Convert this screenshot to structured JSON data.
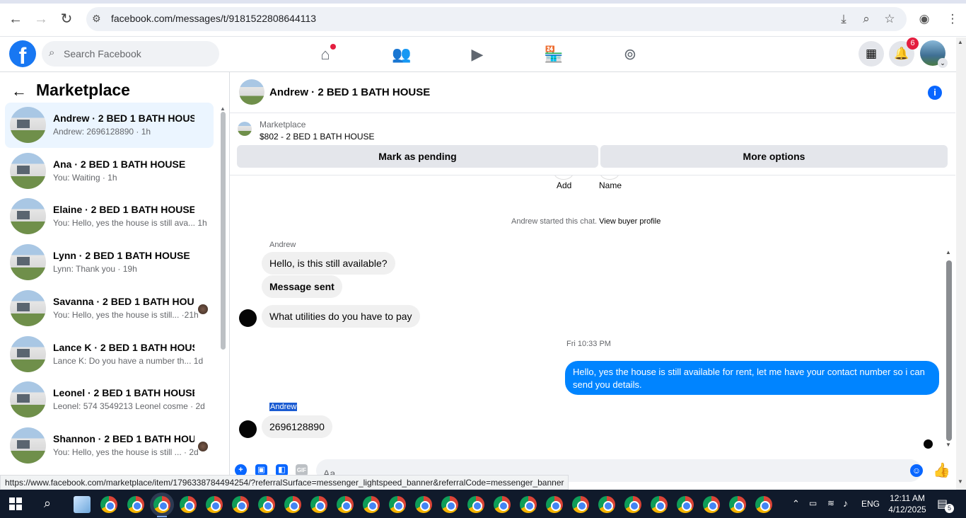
{
  "browser": {
    "url": "facebook.com/messages/t/9181522808644113",
    "status_url": "https://www.facebook.com/marketplace/item/1796338784494254/?referralSurface=messenger_lightspeed_banner&referralCode=messenger_banner"
  },
  "header": {
    "logo": "f",
    "search_placeholder": "Search Facebook",
    "notification_count": "6",
    "accent": "#1877f2"
  },
  "left_panel": {
    "title": "Marketplace",
    "conversations": [
      {
        "name": "Andrew · 2 BED 1 BATH HOUSE",
        "snippet": "Andrew: 2696128890 · 1h",
        "active": true
      },
      {
        "name": "Ana · 2 BED 1 BATH HOUSE",
        "snippet": "You: Waiting · 1h"
      },
      {
        "name": "Elaine · 2 BED 1 BATH HOUSE",
        "snippet": "You: Hello, yes the house is still ava... 1h"
      },
      {
        "name": "Lynn · 2 BED 1 BATH HOUSE",
        "snippet": "Lynn: Thank you · 19h"
      },
      {
        "name": "Savanna · 2 BED 1 BATH HOUSE",
        "snippet": "You: Hello, yes the house is still... ·21h"
      },
      {
        "name": "Lance K · 2 BED 1 BATH HOUSE",
        "snippet": "Lance K: Do you have a number th... 1d"
      },
      {
        "name": "Leonel · 2 BED 1 BATH HOUSE",
        "snippet": "Leonel: 574 3549213 Leonel cosme · 2d"
      },
      {
        "name": "Shannon · 2 BED 1 BATH HOU...",
        "snippet": "You: Hello, yes the house is still ... · 2d"
      }
    ]
  },
  "chat": {
    "title": "Andrew · 2 BED 1 BATH HOUSE",
    "marketplace_label": "Marketplace",
    "item": "$802 - 2 BED 1 BATH HOUSE",
    "mark_pending": "Mark as pending",
    "more_options": "More options",
    "add_label": "Add",
    "name_label": "Name",
    "started_prefix": "Andrew started this chat.",
    "view_buyer": "View buyer profile",
    "sender_name": "Andrew",
    "msg1": "Hello, is this still available?",
    "msg2": "Message sent",
    "msg3": "What utilities do you have to pay",
    "timestamp": "Fri 10:33 PM",
    "my_msg": "Hello, yes the house is still available for rent, let me have your contact number so i can send you details.",
    "sender_name_2": "Andrew",
    "msg4": "2696128890",
    "composer_placeholder": "Aa",
    "gif_label": "GIF",
    "my_bubble_color": "#0084ff"
  },
  "taskbar": {
    "lang": "ENG",
    "time": "12:11 AM",
    "date": "4/12/2025",
    "notif_count": "5"
  }
}
